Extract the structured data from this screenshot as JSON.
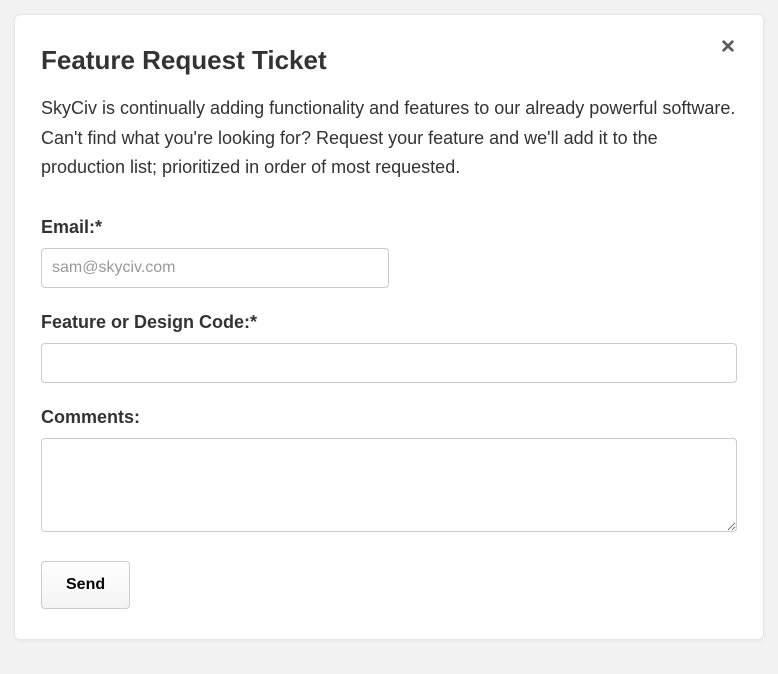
{
  "modal": {
    "title": "Feature Request Ticket",
    "description": "SkyCiv is continually adding functionality and features to our already powerful software. Can't find what you're looking for? Request your feature and we'll add it to the production list; prioritized in order of most requested."
  },
  "form": {
    "email_label": "Email:*",
    "email_placeholder": "sam@skyciv.com",
    "email_value": "",
    "feature_label": "Feature or Design Code:*",
    "feature_value": "",
    "comments_label": "Comments:",
    "comments_value": "",
    "send_label": "Send"
  }
}
